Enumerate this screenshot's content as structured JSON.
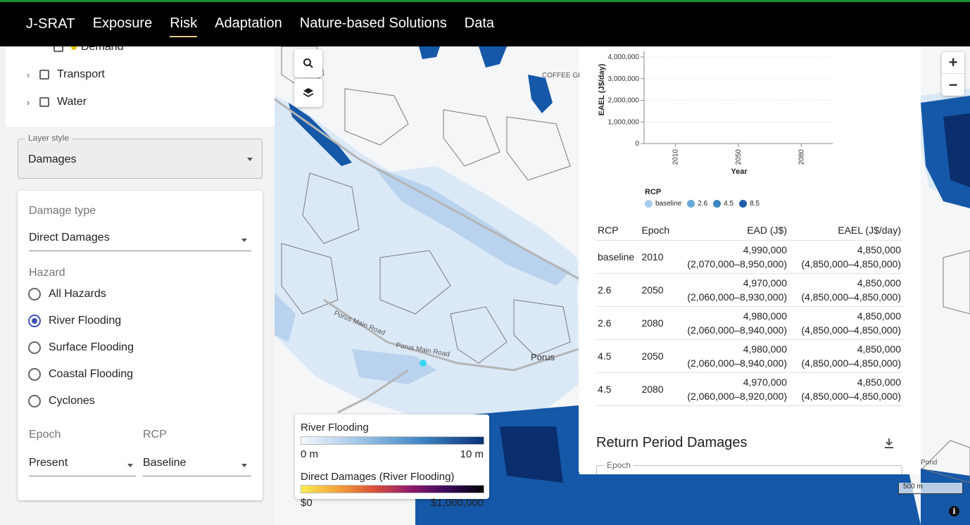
{
  "nav": {
    "brand": "J-SRAT",
    "items": [
      "Exposure",
      "Risk",
      "Adaptation",
      "Nature-based Solutions",
      "Data"
    ],
    "active": "Risk"
  },
  "tree": {
    "demand": "Demand",
    "transport": "Transport",
    "water": "Water"
  },
  "layer_style": {
    "label": "Layer style",
    "value": "Damages"
  },
  "damage_type": {
    "label": "Damage type",
    "value": "Direct Damages"
  },
  "hazard": {
    "label": "Hazard",
    "options": [
      "All Hazards",
      "River Flooding",
      "Surface Flooding",
      "Coastal Flooding",
      "Cyclones"
    ],
    "selected": "River Flooding"
  },
  "epoch": {
    "label": "Epoch",
    "value": "Present"
  },
  "rcp": {
    "label": "RCP",
    "value": "Baseline"
  },
  "legend": {
    "flood_title": "River Flooding",
    "flood_min": "0 m",
    "flood_max": "10 m",
    "damage_title": "Direct Damages (River Flooding)",
    "damage_min": "$0",
    "damage_max": "$1,000,000"
  },
  "map_labels": {
    "coffee": "COFFEE GR",
    "porus": "Porus",
    "road1": "Porus Main Road",
    "road2": "Porus Main Road",
    "pond": "Pond",
    "scale": "500 m"
  },
  "chart_data": {
    "type": "scatter",
    "ylabel": "EAEL (J$/day)",
    "xlabel": "Year",
    "yticks": [
      "0",
      "1,000,000",
      "2,000,000",
      "3,000,000",
      "4,000,000"
    ],
    "xticks": [
      "2010",
      "2050",
      "2080"
    ],
    "ylim": [
      0,
      4000000
    ],
    "legend_title": "RCP",
    "series": [
      {
        "name": "baseline",
        "color": "#a6cde9"
      },
      {
        "name": "2.6",
        "color": "#6aaad6"
      },
      {
        "name": "4.5",
        "color": "#3b86c4"
      },
      {
        "name": "8.5",
        "color": "#1f5fa8"
      }
    ]
  },
  "table": {
    "headers": [
      "RCP",
      "Epoch",
      "EAD (J$)",
      "EAEL (J$/day)"
    ],
    "rows": [
      {
        "rcp": "baseline",
        "epoch": "2010",
        "ead": "4,990,000",
        "ead_range": "(2,070,000–8,950,000)",
        "eael": "4,850,000",
        "eael_range": "(4,850,000–4,850,000)"
      },
      {
        "rcp": "2.6",
        "epoch": "2050",
        "ead": "4,970,000",
        "ead_range": "(2,060,000–8,930,000)",
        "eael": "4,850,000",
        "eael_range": "(4,850,000–4,850,000)"
      },
      {
        "rcp": "2.6",
        "epoch": "2080",
        "ead": "4,980,000",
        "ead_range": "(2,060,000–8,940,000)",
        "eael": "4,850,000",
        "eael_range": "(4,850,000–4,850,000)"
      },
      {
        "rcp": "4.5",
        "epoch": "2050",
        "ead": "4,980,000",
        "ead_range": "(2,060,000–8,940,000)",
        "eael": "4,850,000",
        "eael_range": "(4,850,000–4,850,000)"
      },
      {
        "rcp": "4.5",
        "epoch": "2080",
        "ead": "4,970,000",
        "ead_range": "(2,060,000–8,920,000)",
        "eael": "4,850,000",
        "eael_range": "(4,850,000–4,850,000)"
      }
    ]
  },
  "return_period": {
    "title": "Return Period Damages",
    "epoch_label": "Epoch"
  },
  "colors": {
    "nav_bg": "#000000",
    "accent_green": "#1e8e2e",
    "radio_selected": "#3f51b5",
    "flood_dark": "#0d3f8f"
  }
}
